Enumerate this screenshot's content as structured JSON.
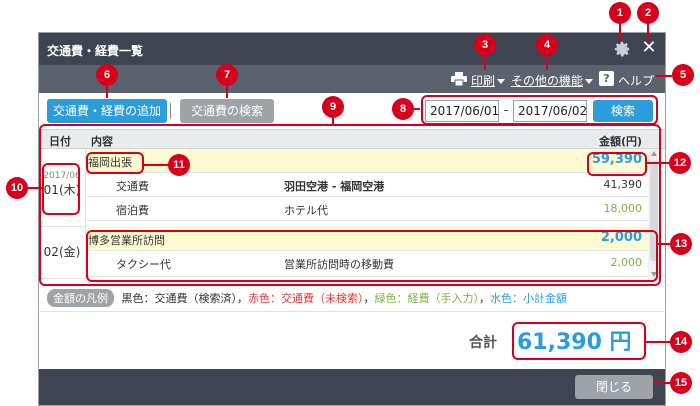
{
  "window": {
    "title": "交通費・経費一覧"
  },
  "menu": {
    "print": "印刷",
    "other": "その他の機能",
    "help": "ヘルプ"
  },
  "toolbar": {
    "add_button": "交通費・経費の追加",
    "search_button": "交通費の検索"
  },
  "date_range": {
    "from": "2017/06/01",
    "separator": "-",
    "to": "2017/06/02",
    "search_label": "検索"
  },
  "table": {
    "headers": {
      "date": "日付",
      "content": "内容",
      "amount": "金額(円)"
    },
    "groups": [
      {
        "date_year": "2017/06",
        "date_day": "01(木)",
        "title": "福岡出張",
        "total": "59,390",
        "items": [
          {
            "type": "交通費",
            "detail": "羽田空港 - 福岡空港",
            "amount": "41,390",
            "amount_color": "#333333"
          },
          {
            "type": "宿泊費",
            "detail": "ホテル代",
            "amount": "18,000",
            "amount_color": "#7cb342"
          }
        ]
      },
      {
        "date_day": "02(金)",
        "title": "博多営業所訪問",
        "total": "2,000",
        "items": [
          {
            "type": "タクシー代",
            "detail": "営業所訪問時の移動費",
            "amount": "2,000",
            "amount_color": "#7cb342"
          }
        ]
      }
    ]
  },
  "legend": {
    "badge": "金額の凡例",
    "black": "黒色：交通費（検索済）",
    "sep1": "，",
    "red": "赤色：交通費（未検索）",
    "sep2": "，",
    "green": "緑色：経費（手入力）",
    "sep3": "，",
    "blue": "水色：小計金額"
  },
  "summary": {
    "label": "合計",
    "amount": "61,390 円"
  },
  "footer": {
    "close_label": "閉じる"
  },
  "callouts": [
    "1",
    "2",
    "3",
    "4",
    "5",
    "6",
    "7",
    "8",
    "9",
    "10",
    "11",
    "12",
    "13",
    "14",
    "15"
  ],
  "colors": {
    "accent_blue": "#2d9cdb",
    "callout_red": "#d6001c",
    "titlebar": "#3e4450",
    "green": "#7cb342",
    "red": "#e53935"
  }
}
